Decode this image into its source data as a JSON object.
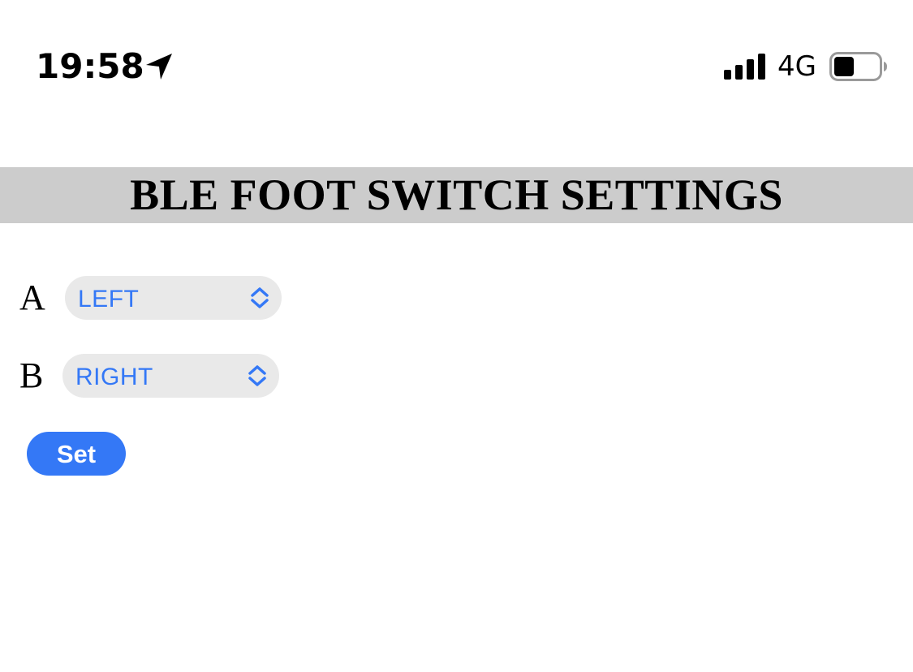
{
  "status_bar": {
    "time": "19:58",
    "location_icon": "location-arrow-icon",
    "signal_icon": "cellular-signal-icon",
    "network": "4G",
    "battery_icon": "battery-icon",
    "battery_level": 0.45
  },
  "header": {
    "title": "BLE FOOT SWITCH SETTINGS",
    "background_color": "#cccccc"
  },
  "form": {
    "switch_a": {
      "label": "A",
      "selected": "LEFT"
    },
    "switch_b": {
      "label": "B",
      "selected": "RIGHT"
    },
    "submit_label": "Set"
  },
  "colors": {
    "accent": "#3478f6",
    "select_background": "#e9e9e9"
  }
}
